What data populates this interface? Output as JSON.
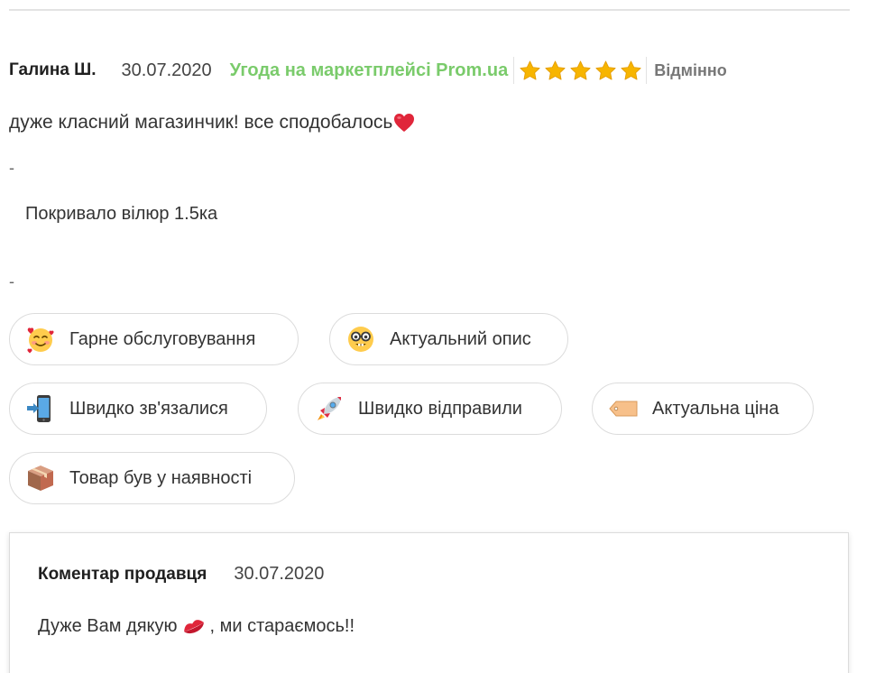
{
  "review": {
    "author": "Галина Ш.",
    "date": "30.07.2020",
    "source": "Угода на маркетплейсі Prom.ua",
    "rating": 5,
    "rating_max": 5,
    "rating_label": "Відмінно",
    "text": "дуже класний магазинчик! все сподобалось",
    "text_emoji": "heart-icon",
    "dash": "-",
    "product": "Покривало вілюр 1.5ка"
  },
  "tags": [
    {
      "label": "Гарне обслуговування",
      "icon": "smiling-face-hearts-icon"
    },
    {
      "label": "Актуальний опис",
      "icon": "nerd-face-icon"
    },
    {
      "label": "Швидко зв'язалися",
      "icon": "phone-arrow-icon"
    },
    {
      "label": "Швидко відправили",
      "icon": "rocket-icon"
    },
    {
      "label": "Актуальна ціна",
      "icon": "price-tag-icon"
    },
    {
      "label": "Товар був у наявності",
      "icon": "package-icon"
    }
  ],
  "seller_comment": {
    "title": "Коментар продавця",
    "date": "30.07.2020",
    "text_before": "Дуже Вам дякую",
    "text_after": ", ми стараємось!!",
    "emoji": "kiss-mark-icon"
  },
  "colors": {
    "source_green": "#7acb6b",
    "star_gold": "#f7b500",
    "heart_red": "#e0263a",
    "chip_border": "#dcdcdc"
  }
}
